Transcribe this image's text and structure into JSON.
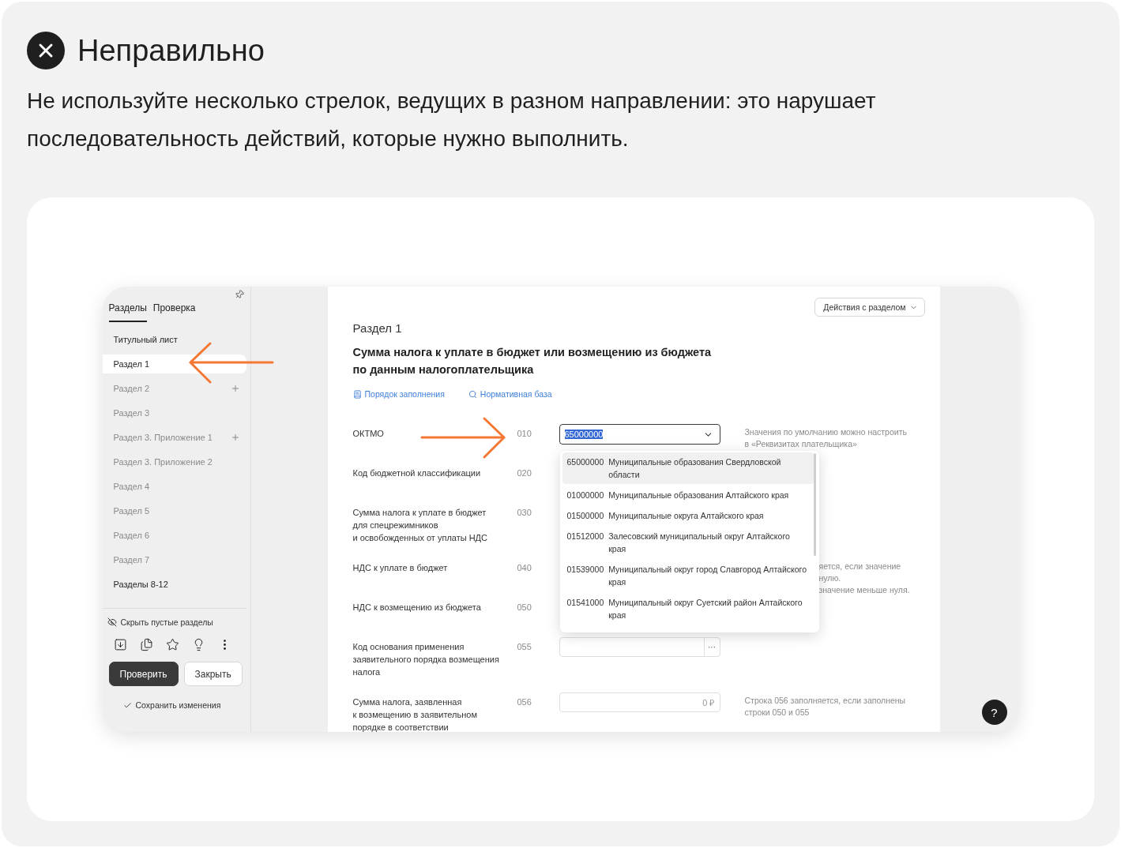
{
  "header": {
    "title": "Неправильно",
    "text": "Не используйте несколько стрелок, ведущих в разном направлении: это нарушает последовательность действий, которые нужно выполнить."
  },
  "app": {
    "sidebar": {
      "tabs": [
        {
          "label": "Разделы",
          "selected": true
        },
        {
          "label": "Проверка",
          "selected": false
        }
      ],
      "items": [
        {
          "label": "Титульный лист",
          "filled": true,
          "selected": false,
          "addable": false
        },
        {
          "label": "Раздел 1",
          "filled": true,
          "selected": true,
          "addable": false
        },
        {
          "label": "Раздел 2",
          "filled": false,
          "selected": false,
          "addable": true
        },
        {
          "label": "Раздел 3",
          "filled": false,
          "selected": false,
          "addable": false
        },
        {
          "label": "Раздел 3. Приложение 1",
          "filled": false,
          "selected": false,
          "addable": true
        },
        {
          "label": "Раздел 3. Приложение 2",
          "filled": false,
          "selected": false,
          "addable": false
        },
        {
          "label": "Раздел 4",
          "filled": false,
          "selected": false,
          "addable": false
        },
        {
          "label": "Раздел 5",
          "filled": false,
          "selected": false,
          "addable": false
        },
        {
          "label": "Раздел 6",
          "filled": false,
          "selected": false,
          "addable": false
        },
        {
          "label": "Раздел 7",
          "filled": false,
          "selected": false,
          "addable": false
        },
        {
          "label": "Разделы 8-12",
          "filled": true,
          "selected": false,
          "addable": false
        }
      ],
      "hide_empty": "Скрыть пустые разделы",
      "buttons": [
        {
          "label": "Проверить",
          "kind": "primary"
        },
        {
          "label": "Закрыть",
          "kind": "secondary"
        }
      ],
      "save": "Сохранить изменения"
    },
    "main": {
      "actions": "Действия с разделом",
      "section": "Раздел 1",
      "title": [
        "Сумма налога к уплате в бюджет или возмещению из бюджета",
        "по данным налогоплательщика"
      ],
      "links": [
        "Порядок заполнения",
        "Нормативная база"
      ],
      "rows": [
        {
          "label": [
            "ОКТМО"
          ],
          "code": "010",
          "field": {
            "kind": "select",
            "value": "65000000"
          },
          "hint": {
            "kind": "plain",
            "lines": [
              "Значения по умолчанию можно настроить",
              "в «Реквизитах плательщика»"
            ]
          }
        },
        {
          "label": [
            "Код бюджетной классификации"
          ],
          "code": "020"
        },
        {
          "label": [
            "Сумма налога к уплате в бюджет",
            "для спецрежимников",
            "и освобожденных от уплаты НДС"
          ],
          "code": "030"
        },
        {
          "label": [
            "НДС к уплате в бюджет"
          ],
          "code": "040",
          "hint": {
            "kind": "covered",
            "lines": [
              "яется, если значение",
              "нулю.",
              "значение меньше нуля."
            ]
          }
        },
        {
          "label": [
            "НДС к возмещению из бюджета"
          ],
          "code": "050"
        },
        {
          "label": [
            "Код основания применения",
            "заявительного порядка возмещения",
            "налога"
          ],
          "code": "055",
          "field": {
            "kind": "lookup",
            "action": "···"
          }
        },
        {
          "label": [
            "Сумма налога, заявленная",
            "к возмещению в заявительном",
            "порядке в соответствии"
          ],
          "code": "056",
          "field": {
            "kind": "amount",
            "placeholder": "0 ₽"
          },
          "hint": {
            "kind": "plain",
            "lines": [
              "Строка 056 заполняется, если заполнены",
              "строки 050 и 055"
            ]
          }
        }
      ],
      "dropdown": [
        {
          "code": "65000000",
          "name": "Муниципальные образования Свердловской области",
          "selected": true
        },
        {
          "code": "01000000",
          "name": "Муниципальные образования Алтайского края",
          "selected": false
        },
        {
          "code": "01500000",
          "name": "Муниципальные округа Алтайского края",
          "selected": false
        },
        {
          "code": "01512000",
          "name": "Залесовский муниципальный округ Алтайского края",
          "selected": false
        },
        {
          "code": "01539000",
          "name": "Муниципальный округ город Славгород Алтайского края",
          "selected": false
        },
        {
          "code": "01541000",
          "name": "Муниципальный округ Суетский район Алтайского края",
          "selected": false
        }
      ]
    },
    "help": "?"
  }
}
